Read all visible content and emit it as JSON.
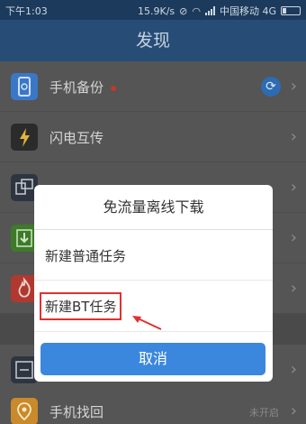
{
  "statusbar": {
    "time": "下午1:03",
    "speed": "15.9K/s",
    "carrier": "中国移动 4G"
  },
  "header": {
    "title": "发现"
  },
  "list": {
    "items": [
      {
        "label": "手机备份",
        "icon": "phone-backup-icon",
        "icon_color": "#3a78c7",
        "has_dot": true,
        "has_sync": true
      },
      {
        "label": "闪电互传",
        "icon": "lightning-icon",
        "icon_color": "#2b2b2b"
      },
      {
        "label": "",
        "icon": "screens-icon",
        "icon_color": "#2e3540"
      },
      {
        "label": "",
        "icon": "download-icon",
        "icon_color": "#3e7a2a"
      },
      {
        "label": "",
        "icon": "flame-icon",
        "icon_color": "#b0392f"
      },
      {
        "label": "",
        "icon": "expand-icon",
        "icon_color": "#2e3540"
      },
      {
        "label": "手机找回",
        "icon": "location-icon",
        "icon_color": "#c88a2a",
        "state": "未开启"
      }
    ]
  },
  "dialog": {
    "title": "免流量离线下载",
    "options": [
      {
        "label": "新建普通任务"
      },
      {
        "label": "新建BT任务"
      }
    ],
    "cancel_label": "取消"
  },
  "colors": {
    "header": "#274d77",
    "accent": "#3b87dd",
    "highlight": "#e03131"
  }
}
